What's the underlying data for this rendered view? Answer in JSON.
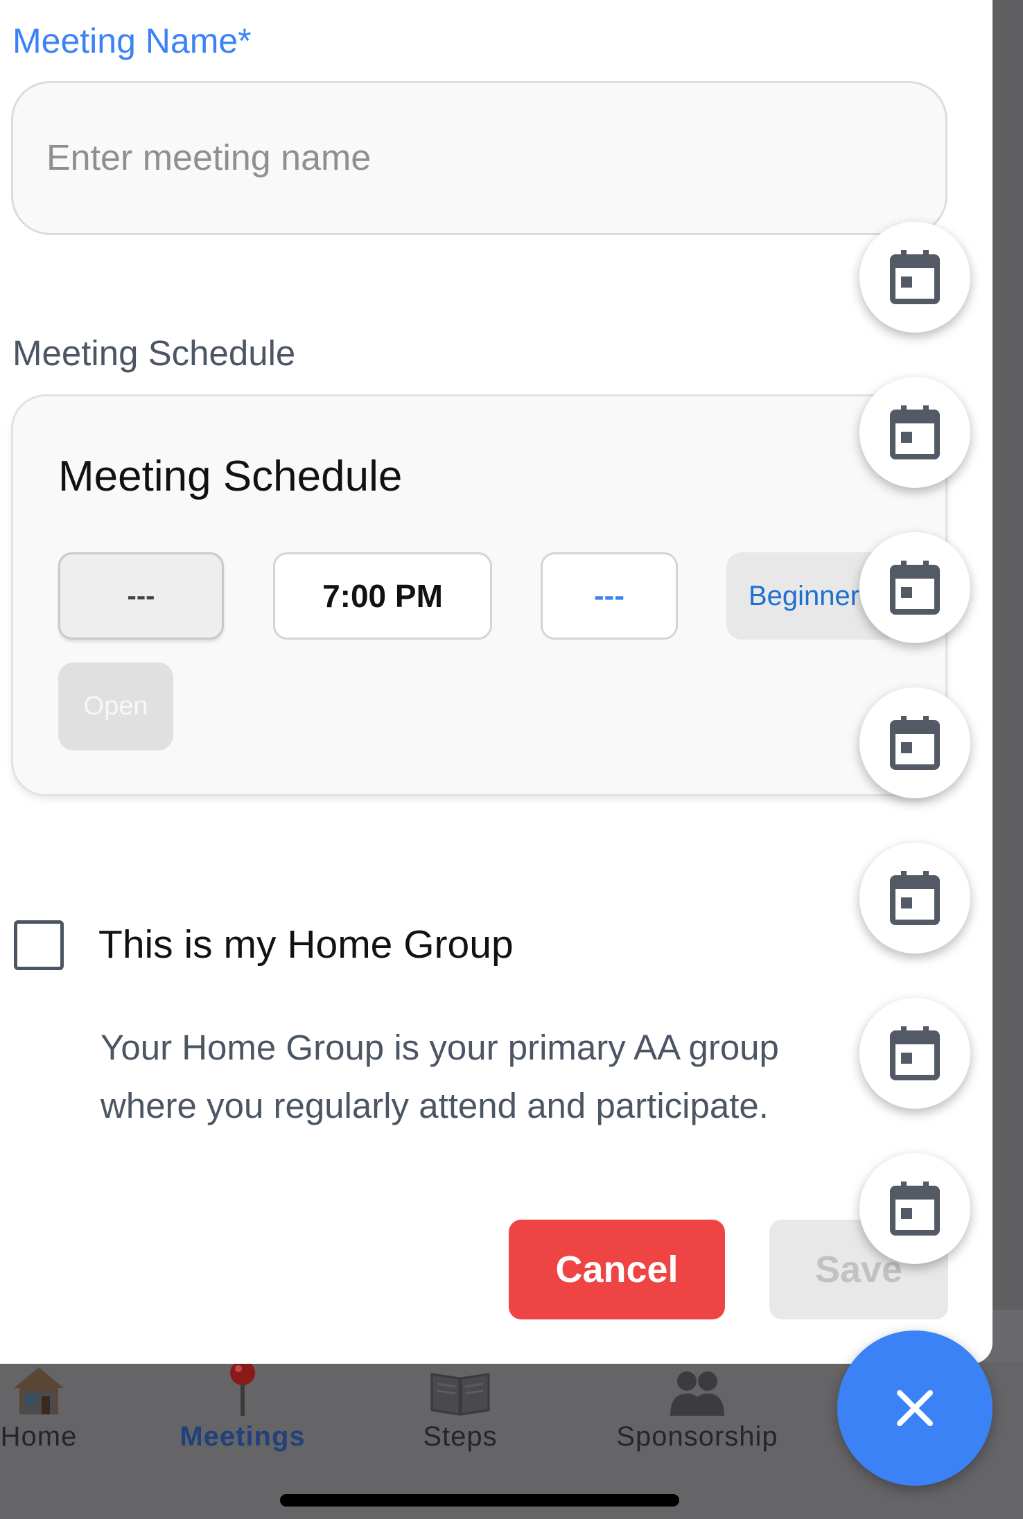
{
  "form": {
    "name_label": "Meeting Name*",
    "name_value": "",
    "name_placeholder": "Enter meeting name",
    "schedule_label": "Meeting Schedule",
    "schedule_card_title": "Meeting Schedule",
    "chips": {
      "day": "---",
      "time": "7:00 PM",
      "type": "---",
      "beginner": "Beginner",
      "open": "Open"
    },
    "home_group": {
      "checked": false,
      "label": "This is my Home Group",
      "description": "Your Home Group is your primary AA group where you regularly attend and participate."
    },
    "cancel_label": "Cancel",
    "save_label": "Save"
  },
  "speed_dial": {
    "count": 7,
    "icon": "calendar-icon",
    "close_icon": "close-icon"
  },
  "tabbar": {
    "items": [
      {
        "label": "Home",
        "icon": "house-icon",
        "active": false
      },
      {
        "label": "Meetings",
        "icon": "pin-icon",
        "active": true
      },
      {
        "label": "Steps",
        "icon": "book-icon",
        "active": false
      },
      {
        "label": "Sponsorship",
        "icon": "people-icon",
        "active": false
      }
    ]
  },
  "colors": {
    "accent": "#3b82f6",
    "cancel": "#ef4444",
    "active_tab": "#22407a"
  }
}
